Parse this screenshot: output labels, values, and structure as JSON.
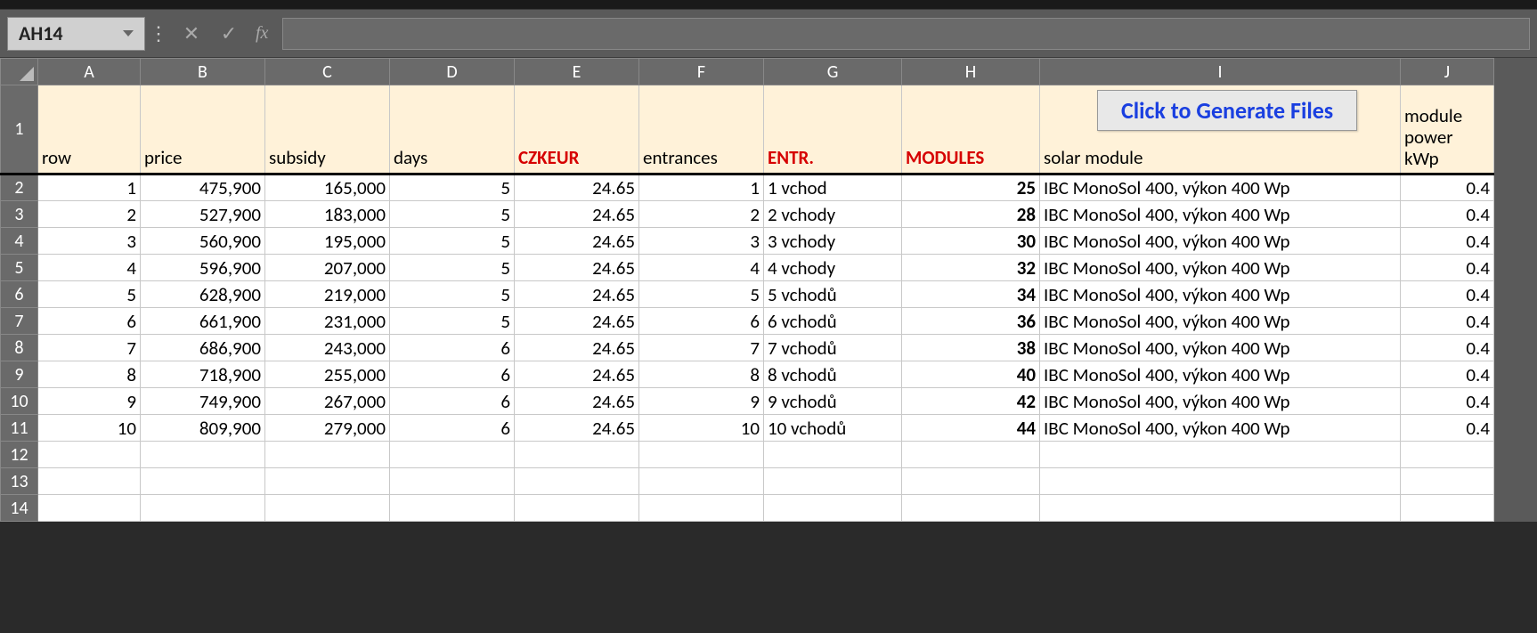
{
  "nameBox": "AH14",
  "fxLabel": "fx",
  "generateButton": "Click to Generate Files",
  "columns": [
    "A",
    "B",
    "C",
    "D",
    "E",
    "F",
    "G",
    "H",
    "I",
    "J"
  ],
  "rowNumbers": [
    "1",
    "2",
    "3",
    "4",
    "5",
    "6",
    "7",
    "8",
    "9",
    "10",
    "11",
    "12",
    "13",
    "14"
  ],
  "headers": {
    "A": {
      "text": "row",
      "cls": ""
    },
    "B": {
      "text": "price",
      "cls": ""
    },
    "C": {
      "text": "subsidy",
      "cls": ""
    },
    "D": {
      "text": "days",
      "cls": ""
    },
    "E": {
      "text": "CZKEUR",
      "cls": "red-bold"
    },
    "F": {
      "text": "entrances",
      "cls": ""
    },
    "G": {
      "text": "ENTR.",
      "cls": "red-bold"
    },
    "H": {
      "text": "MODULES",
      "cls": "red-bold"
    },
    "I": {
      "text": "solar module",
      "cls": ""
    },
    "J": {
      "text": "module power kWp",
      "cls": ""
    }
  },
  "jHeaderLines": [
    "module",
    "power",
    "kWp"
  ],
  "rows": [
    {
      "A": "1",
      "B": "475,900",
      "C": "165,000",
      "D": "5",
      "E": "24.65",
      "F": "1",
      "G": "1 vchod",
      "H": "25",
      "I": "IBC MonoSol 400, výkon 400 Wp",
      "J": "0.4"
    },
    {
      "A": "2",
      "B": "527,900",
      "C": "183,000",
      "D": "5",
      "E": "24.65",
      "F": "2",
      "G": "2 vchody",
      "H": "28",
      "I": "IBC MonoSol 400, výkon 400 Wp",
      "J": "0.4"
    },
    {
      "A": "3",
      "B": "560,900",
      "C": "195,000",
      "D": "5",
      "E": "24.65",
      "F": "3",
      "G": "3 vchody",
      "H": "30",
      "I": "IBC MonoSol 400, výkon 400 Wp",
      "J": "0.4"
    },
    {
      "A": "4",
      "B": "596,900",
      "C": "207,000",
      "D": "5",
      "E": "24.65",
      "F": "4",
      "G": "4 vchody",
      "H": "32",
      "I": "IBC MonoSol 400, výkon 400 Wp",
      "J": "0.4"
    },
    {
      "A": "5",
      "B": "628,900",
      "C": "219,000",
      "D": "5",
      "E": "24.65",
      "F": "5",
      "G": "5 vchodů",
      "H": "34",
      "I": "IBC MonoSol 400, výkon 400 Wp",
      "J": "0.4"
    },
    {
      "A": "6",
      "B": "661,900",
      "C": "231,000",
      "D": "5",
      "E": "24.65",
      "F": "6",
      "G": "6 vchodů",
      "H": "36",
      "I": "IBC MonoSol 400, výkon 400 Wp",
      "J": "0.4"
    },
    {
      "A": "7",
      "B": "686,900",
      "C": "243,000",
      "D": "6",
      "E": "24.65",
      "F": "7",
      "G": "7 vchodů",
      "H": "38",
      "I": "IBC MonoSol 400, výkon 400 Wp",
      "J": "0.4"
    },
    {
      "A": "8",
      "B": "718,900",
      "C": "255,000",
      "D": "6",
      "E": "24.65",
      "F": "8",
      "G": "8 vchodů",
      "H": "40",
      "I": "IBC MonoSol 400, výkon 400 Wp",
      "J": "0.4"
    },
    {
      "A": "9",
      "B": "749,900",
      "C": "267,000",
      "D": "6",
      "E": "24.65",
      "F": "9",
      "G": "9 vchodů",
      "H": "42",
      "I": "IBC MonoSol 400, výkon 400 Wp",
      "J": "0.4"
    },
    {
      "A": "10",
      "B": "809,900",
      "C": "279,000",
      "D": "6",
      "E": "24.65",
      "F": "10",
      "G": "10 vchodů",
      "H": "44",
      "I": "IBC MonoSol 400, výkon 400 Wp",
      "J": "0.4"
    }
  ]
}
